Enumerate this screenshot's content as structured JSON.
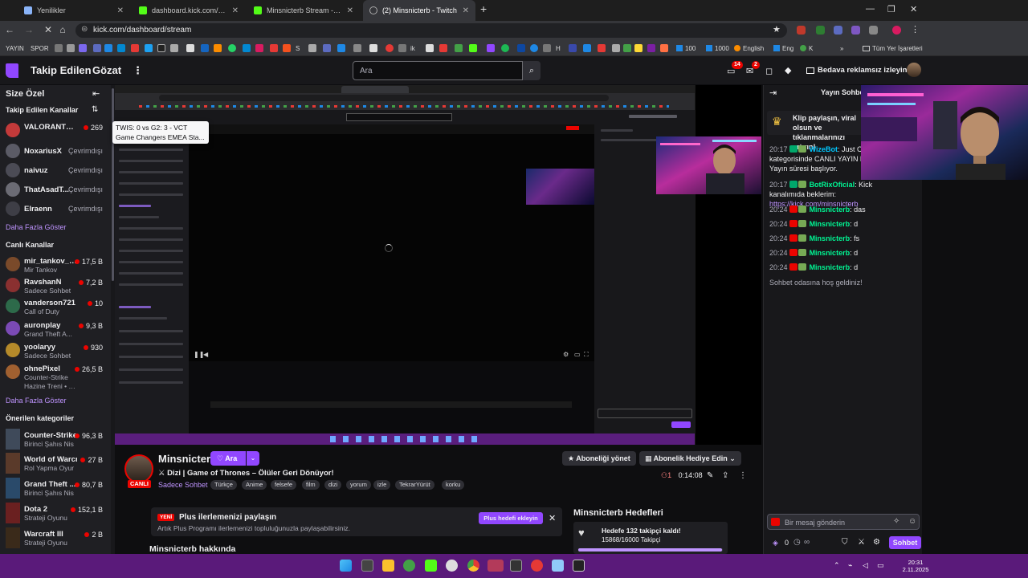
{
  "browser": {
    "tabs": [
      {
        "title": "Yenilikler",
        "active": false
      },
      {
        "title": "dashboard.kick.com/popout/m",
        "active": false
      },
      {
        "title": "Minsnicterb Stream - Watch Li",
        "active": false
      },
      {
        "title": "(2) Minsnicterb - Twitch",
        "active": true
      }
    ],
    "url": "kick.com/dashboard/stream",
    "bookmarks": {
      "yayin": "YAYIN",
      "spor": "SPOR",
      "s": "S",
      "ik": "ik",
      "h": "H",
      "eng": "Eng",
      "english": "English",
      "k": "K",
      "n100a": "100",
      "n1000": "1000",
      "n100b": "100",
      "all_bookmarks": "Tüm Yer İşaretleri"
    }
  },
  "twitch_nav": {
    "following": "Takip Edilen",
    "browse": "Gözat",
    "search_placeholder": "Ara",
    "badge_inbox": "14",
    "badge_whispers": "2",
    "prime_label": "Bedava reklamsız izleyin"
  },
  "sidebar": {
    "title": "Size Özel",
    "followed_heading": "Takip Edilen Kanallar",
    "followed": [
      {
        "name": "VALORANT_TUR",
        "category": "",
        "viewers": "269",
        "live": true,
        "color": "#c33a3a"
      },
      {
        "name": "NoxariusX",
        "category": "",
        "status": "Çevrimdışı",
        "live": false,
        "color": "#5b5b66"
      },
      {
        "name": "naivuz",
        "category": "",
        "status": "Çevrimdışı",
        "live": false,
        "color": "#4b4b55"
      },
      {
        "name": "ThatAsadT...",
        "category": "",
        "status": "Çevrimdışı",
        "live": false,
        "color": "#6b6b74"
      },
      {
        "name": "Elraenn",
        "category": "",
        "status": "Çevrimdışı",
        "live": false,
        "color": "#3e3e46"
      }
    ],
    "show_more_1": "Daha Fazla Göster",
    "live_heading": "Canlı Kanallar",
    "live": [
      {
        "name": "mir_tankov_of...",
        "category": "Mir Tankov",
        "viewers": "17,5 B",
        "color": "#7a4a2a"
      },
      {
        "name": "RavshanN",
        "category": "Sadece Sohbet",
        "viewers": "7,2 B",
        "color": "#8a3030"
      },
      {
        "name": "vanderson721",
        "category": "Call of Duty",
        "viewers": "10",
        "color": "#2d6a4a"
      },
      {
        "name": "auronplay",
        "category": "Grand Theft A...",
        "viewers": "9,3 B",
        "color": "#7b4ab5"
      },
      {
        "name": "yoolaryy",
        "category": "Sadece Sohbet",
        "viewers": "930",
        "color": "#b58a2a"
      },
      {
        "name": "ohnePixel",
        "category": "Counter-Strike",
        "viewers": "26,5 B",
        "color": "#a06030",
        "extra": "Hazine Treni • Sevi..."
      }
    ],
    "show_more_2": "Daha Fazla Göster",
    "rec_heading": "Önerilen kategoriler",
    "categories": [
      {
        "name": "Counter-Strike",
        "category": "Birinci Şahıs Nis",
        "viewers": "96,3 B",
        "color": "#3f4a5a"
      },
      {
        "name": "World of Warcr...",
        "category": "Rol Yapma Oyunu",
        "viewers": "27 B",
        "color": "#5a3a2a"
      },
      {
        "name": "Grand Theft ...",
        "category": "Birinci Şahıs Nis",
        "viewers": "80,7 B",
        "color": "#2a4a6a"
      },
      {
        "name": "Dota 2",
        "category": "Strateji Oyunu",
        "viewers": "152,1 B",
        "color": "#6a2020"
      },
      {
        "name": "Warcraft III",
        "category": "Strateji Oyunu",
        "viewers": "2 B",
        "color": "#3a2a1a"
      }
    ]
  },
  "tooltip": {
    "line1": "TWIS: 0 vs G2: 3 - VCT",
    "line2": "Game Changers EMEA Sta..."
  },
  "channel": {
    "name": "Minsnicterb",
    "live_label": "CANLI",
    "follow_label": "Ara",
    "title": "Dizi | Game of Thrones – Ölüler Geri Dönüyor!",
    "category": "Sadece Sohbet",
    "tags": [
      "Türkçe",
      "Anime",
      "felsefe",
      "film",
      "dizi",
      "yorum",
      "izle",
      "TekrarYürüt",
      "korku"
    ],
    "manage_sub": "Aboneliği yönet",
    "gift_sub": "Abonelik Hediye Edin",
    "viewers": "1",
    "uptime": "0:14:08",
    "plus_new": "YENİ",
    "plus_title": "Plus ilerlemenizi paylaşın",
    "plus_desc": "Artık Plus Programı ilerlemenizi topluluğunuzla paylaşabilirsiniz.",
    "plus_button": "Plus hedefi ekleyin",
    "about": "Minsnicterb hakkında",
    "goals_title": "Minsnicterb Hedefleri",
    "goal_text": "Hedefe 132 takipçi kaldı!",
    "goal_sub": "15868/16000 Takipçi",
    "goal_progress": 0.9918
  },
  "chat": {
    "header": "Yayın Sohbeti",
    "clip_text": "Klip paylaşın, viral olsun ve tıklanmalarınızı artırın!",
    "messages": [
      {
        "time": "20:17",
        "user": "WizeBot",
        "text": "Just Chatting kategorisinde CANLI YAYIN başladı! Yayın süresi başlıyor."
      },
      {
        "time": "20:17",
        "user": "BotRixOficial",
        "text": "Kick kanalımıda beklerim: ",
        "link": "https://kick.com/minsnicterb"
      },
      {
        "time": "20:24",
        "user": "Minsnicterb",
        "text": "das"
      },
      {
        "time": "20:24",
        "user": "Minsnicterb",
        "text": "d"
      },
      {
        "time": "20:24",
        "user": "Minsnicterb",
        "text": "fs"
      },
      {
        "time": "20:24",
        "user": "Minsnicterb",
        "text": "d"
      },
      {
        "time": "20:24",
        "user": "Minsnicterb",
        "text": "d"
      }
    ],
    "welcome": "Sohbet odasına hoş geldiniz!",
    "input_placeholder": "Bir mesaj gönderin",
    "points": "0",
    "send_label": "Sohbet"
  },
  "taskbar": {
    "time": "20:31",
    "date": "2.11.2025"
  },
  "colors": {
    "twitch_purple": "#9147ff",
    "live_red": "#eb0400",
    "chat_user": "#00f593",
    "taskbar": "#5a1a7a"
  }
}
